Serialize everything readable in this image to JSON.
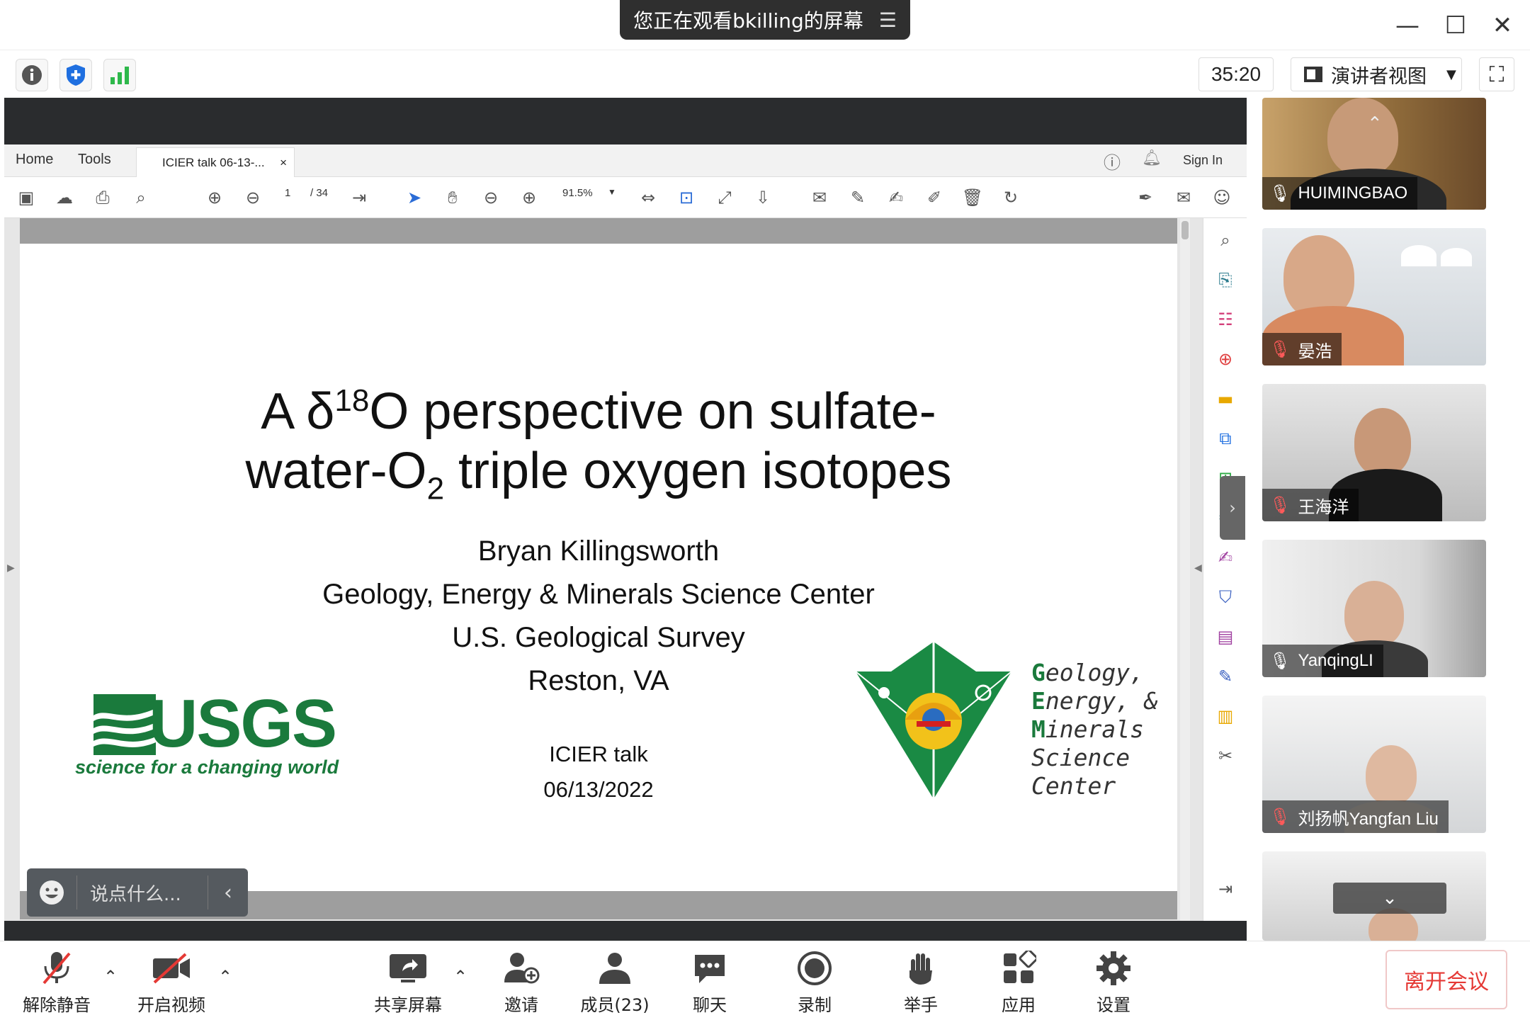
{
  "title_bar": {
    "share_notice": "您正在观看bkilling的屏幕",
    "menu_icon": "list-menu-icon",
    "minimize_icon": "minimize-icon",
    "maximize_icon": "maximize-icon",
    "close_icon": "close-icon"
  },
  "top_bar": {
    "info_icon": "info-icon",
    "security_icon": "shield-plus-icon",
    "signal_icon": "signal-bars-icon",
    "timer": "35:20",
    "view_mode": "演讲者视图",
    "fullscreen_icon": "fullscreen-icon"
  },
  "reader": {
    "tabs": {
      "home": "Home",
      "tools": "Tools",
      "doc_tab": "ICIER talk 06-13-...",
      "close": "×"
    },
    "sign_in": "Sign In",
    "page_current": "1",
    "page_total": "/ 34",
    "zoom": "91.5%",
    "accent": "#2b6cd6"
  },
  "slide": {
    "title_line1_a": "A δ",
    "title_sup": "18",
    "title_line1_b": "O perspective on sulfate-",
    "title_line2_a": "water-O",
    "title_sub": "2",
    "title_line2_b": " triple oxygen isotopes",
    "author": "Bryan Killingsworth",
    "affiliation": "Geology, Energy & Minerals Science Center",
    "org": "U.S. Geological Survey",
    "location": "Reston, VA",
    "event": "ICIER talk",
    "date": "06/13/2022",
    "usgs_logo_text": "USGS",
    "usgs_tagline": "science for a changing world",
    "gemsc": {
      "l1_cap": "G",
      "l1_rest": "eology,",
      "l2_cap": "E",
      "l2_rest": "nergy, &",
      "l3_cap": "M",
      "l3_rest": "inerals",
      "l4": "Science",
      "l5": "Center"
    },
    "brand_green": "#1a7a3c"
  },
  "chat_input": {
    "placeholder": "说点什么...",
    "emoji_icon": "smiley-icon",
    "collapse_icon": "chevron-left-icon"
  },
  "participants": [
    {
      "name": "HUIMINGBAO",
      "mic": "mic-on"
    },
    {
      "name": "晏浩",
      "mic": "mic-muted"
    },
    {
      "name": "王海洋",
      "mic": "mic-muted"
    },
    {
      "name": "YanqingLI",
      "mic": "mic-on"
    },
    {
      "name": "刘扬帆Yangfan Liu",
      "mic": "mic-muted"
    }
  ],
  "bottom_bar": {
    "unmute": "解除静音",
    "start_video": "开启视频",
    "share_screen": "共享屏幕",
    "invite": "邀请",
    "members": "成员(23)",
    "chat": "聊天",
    "record": "录制",
    "raise_hand": "举手",
    "apps": "应用",
    "settings": "设置",
    "leave": "离开会议"
  }
}
